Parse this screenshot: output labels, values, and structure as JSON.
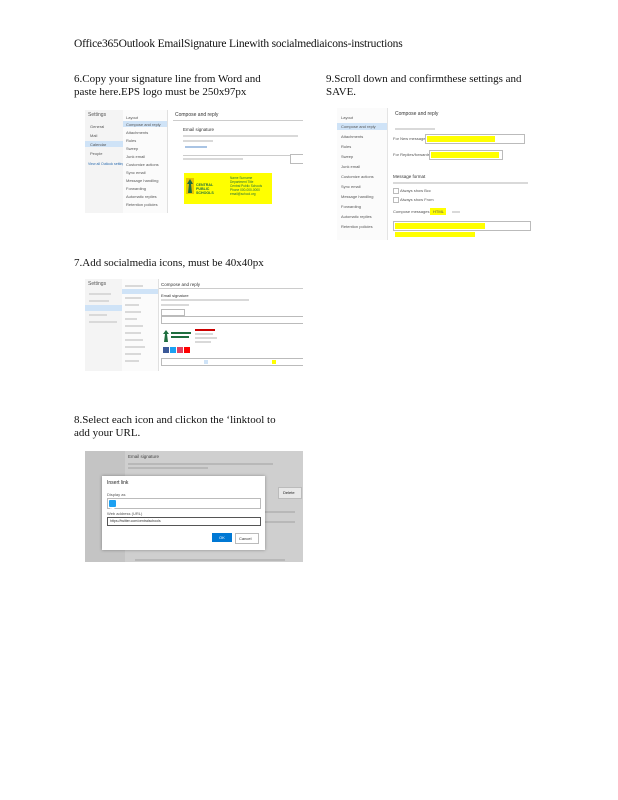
{
  "doc": {
    "title": "Office365Outlook EmailSignature Linewith socialmediaicons-instructions"
  },
  "steps": [
    {
      "line1": "6.Copy your signature line from Word and",
      "line2": "paste here.EPS logo must be 250x97px"
    },
    {
      "line1": "9.Scroll down and confirmthese settings and",
      "line2": "SAVE."
    },
    {
      "line1": "7.Add socialmedia icons, must be 40x40px",
      "line2": ""
    },
    {
      "line1": "8.Select each icon and clickon the ‘linktool to",
      "line2": "add your URL."
    }
  ],
  "shot1": {
    "nav_title": "Settings",
    "nav_items": [
      "General",
      "Mail",
      "Calendar",
      "People",
      "View all Outlook settings"
    ],
    "mid_items": [
      "Layout",
      "Compose and reply",
      "Attachments",
      "Rules",
      "Sweep",
      "Junk email",
      "Customize actions",
      "Sync email",
      "Message handling",
      "Forwarding",
      "Automatic replies",
      "Retention policies"
    ],
    "panel_title": "Compose and reply",
    "panel_heading": "Email signature",
    "logo_text": "CENTRAL PUBLIC SCHOOLS",
    "contact_lines": [
      "Name Surname",
      "Department Title",
      "Central Public Schools",
      "Phone 000-000-0000",
      "email@school.org"
    ]
  },
  "shot2": {
    "panel_title": "Compose and reply",
    "nav_items": [
      "Layout",
      "Compose and reply",
      "Attachments",
      "Rules",
      "Sweep",
      "Junk email",
      "Customize actions",
      "Sync email",
      "Message handling",
      "Forwarding",
      "Automatic replies",
      "Retention policies"
    ],
    "label_new": "For New messages",
    "label_replies": "For Replies/forwards",
    "section": "Message format",
    "checkbox1": "Always show Bcc",
    "checkbox2": "Always show From",
    "format_label": "Compose messages in",
    "format_value": "HTML"
  },
  "shot3": {
    "nav_title": "Settings",
    "panel_title": "Compose and reply",
    "panel_heading": "Email signature",
    "social_colors": [
      "#3b5998",
      "#1da1f2",
      "#e4405f",
      "#ff0000"
    ]
  },
  "shot4": {
    "bg_title": "Email signature",
    "dialog_title": "Insert link",
    "display_label": "Display as",
    "web_label": "Web address (URL)",
    "url_value": "https://twitter.com/centralschools",
    "ok_label": "OK",
    "cancel_label": "Cancel",
    "side_button": "Delete"
  }
}
